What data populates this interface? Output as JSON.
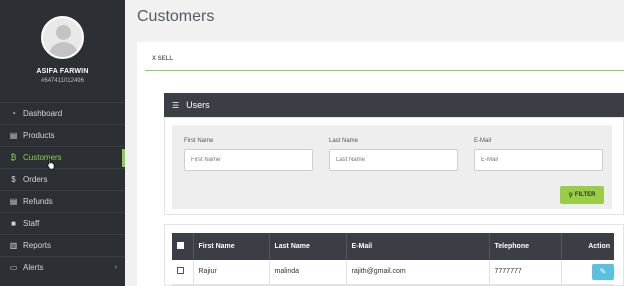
{
  "sidebar": {
    "user_name": "ASIFA FARWIN",
    "user_id": "#647411012496",
    "items": [
      {
        "label": "Dashboard",
        "icon": "dashboard-icon",
        "glyph": "◔"
      },
      {
        "label": "Products",
        "icon": "cart-icon",
        "glyph": "▤"
      },
      {
        "label": "Customers",
        "icon": "bitcoin-icon",
        "glyph": "₿",
        "active": true
      },
      {
        "label": "Orders",
        "icon": "dollar-icon",
        "glyph": "$"
      },
      {
        "label": "Refunds",
        "icon": "cart-icon",
        "glyph": "▤"
      },
      {
        "label": "Staff",
        "icon": "briefcase-icon",
        "glyph": "■"
      },
      {
        "label": "Reports",
        "icon": "bar-chart-icon",
        "glyph": "▥"
      },
      {
        "label": "Alerts",
        "icon": "monitor-icon",
        "glyph": "▭",
        "chevron": "›"
      }
    ]
  },
  "main": {
    "page_title": "Customers",
    "tab_label": "X SELL",
    "users_title": "Users",
    "filters": {
      "first_name_label": "First Name",
      "first_name_placeholder": "First Name",
      "last_name_label": "Last Name",
      "last_name_placeholder": "Last Name",
      "email_label": "E-Mail",
      "email_placeholder": "E-Mail",
      "filter_button": "FILTER"
    },
    "table": {
      "headers": [
        "First Name",
        "Last Name",
        "E-Mail",
        "Telephone",
        "Action"
      ],
      "rows": [
        {
          "first_name": "Rajiur",
          "last_name": "malinda",
          "email": "rajith@gmail.com",
          "telephone": "7777777"
        }
      ]
    }
  },
  "colors": {
    "sidebar_bg": "#2c2f33",
    "accent": "#8ad14e",
    "header_dark": "#3b3f45",
    "filter_button": "#9acd47",
    "edit_button": "#5bc0de"
  }
}
